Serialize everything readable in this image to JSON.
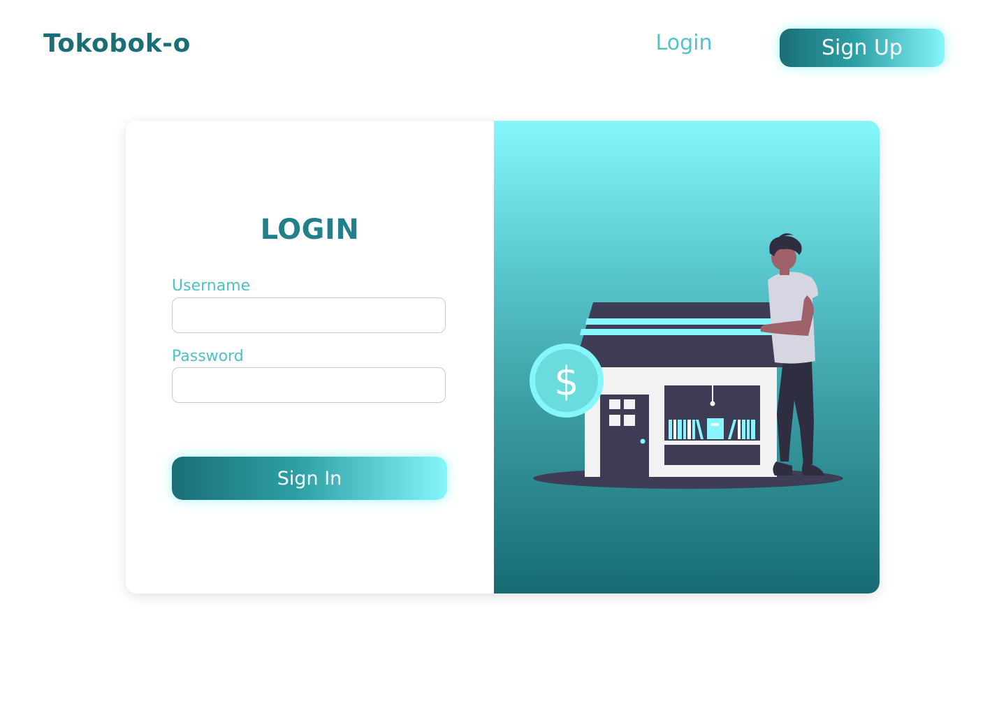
{
  "header": {
    "brand": "Tokobok-o",
    "nav": {
      "login_label": "Login",
      "signup_label": "Sign Up"
    }
  },
  "login_form": {
    "title": "LOGIN",
    "username_label": "Username",
    "username_value": "",
    "password_label": "Password",
    "password_value": "",
    "submit_label": "Sign In"
  },
  "illustration": {
    "icon": "store-with-person-icon",
    "coin_symbol": "$"
  },
  "colors": {
    "brand": "#1b6e76",
    "accent": "#4ec3c8",
    "highlight": "#86f5fc",
    "building_dark": "#3f3d56",
    "building_light": "#f2f2f2"
  }
}
